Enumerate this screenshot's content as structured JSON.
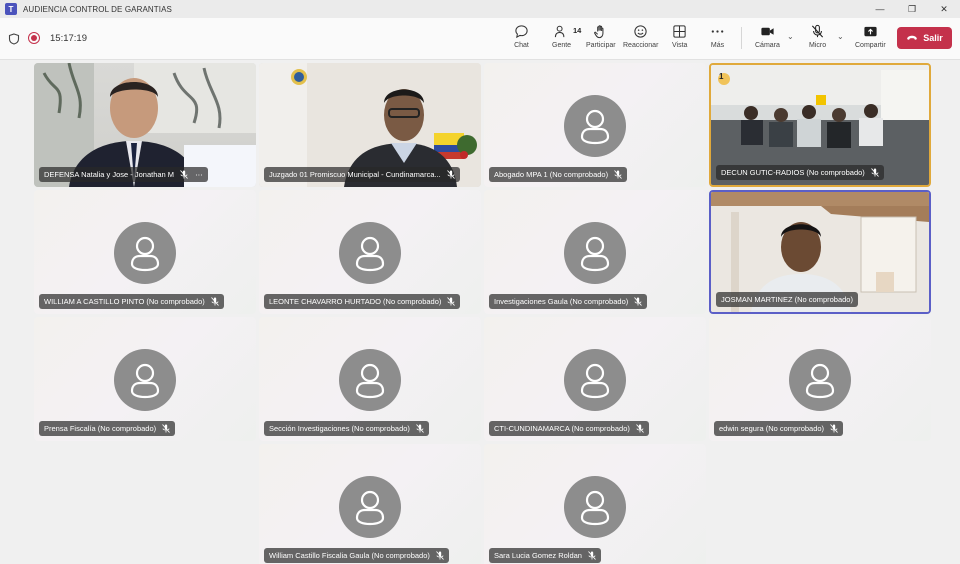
{
  "window": {
    "title": "AUDIENCIA CONTROL DE GARANTIAS"
  },
  "toolbar": {
    "timer": "15:17:19",
    "chat": "Chat",
    "people": "Gente",
    "people_count": "14",
    "raise": "Participar",
    "react": "Reaccionar",
    "view": "Vista",
    "more": "Más",
    "camera": "Cámara",
    "mic": "Micro",
    "share": "Compartir",
    "leave": "Salir"
  },
  "reaction_badge": "1",
  "participants": [
    {
      "name": "DEFENSA Natalia y Jose - Jonathan M",
      "video": true
    },
    {
      "name": "Juzgado 01 Promiscuo Municipal - Cundinamarca...",
      "video": true
    },
    {
      "name": "Abogado MPA 1 (No comprobado)",
      "video": false
    },
    {
      "name": "DECUN GUTIC-RADIOS (No comprobado)",
      "video": true
    },
    {
      "name": "WILLIAM A CASTILLO PINTO (No comprobado)",
      "video": false
    },
    {
      "name": "LEONTE CHAVARRO HURTADO (No comprobado)",
      "video": false
    },
    {
      "name": "Investigaciones Gaula (No comprobado)",
      "video": false
    },
    {
      "name": "JOSMAN MARTINEZ (No comprobado)",
      "video": true
    },
    {
      "name": "Prensa Fiscalía (No comprobado)",
      "video": false
    },
    {
      "name": "Sección Investigaciones (No comprobado)",
      "video": false
    },
    {
      "name": "CTI-CUNDINAMARCA (No comprobado)",
      "video": false
    },
    {
      "name": "edwin segura (No comprobado)",
      "video": false
    },
    {
      "name": "William Castillo Fiscalia Gaula (No comprobado)",
      "video": false
    },
    {
      "name": "Sara Lucia Gomez Roldan",
      "video": false
    }
  ],
  "colors": {
    "leave": "#c4314b",
    "active_speaker": "#e0a93b",
    "pinned": "#5b5fc7",
    "avatar": "#8d8d8d"
  }
}
